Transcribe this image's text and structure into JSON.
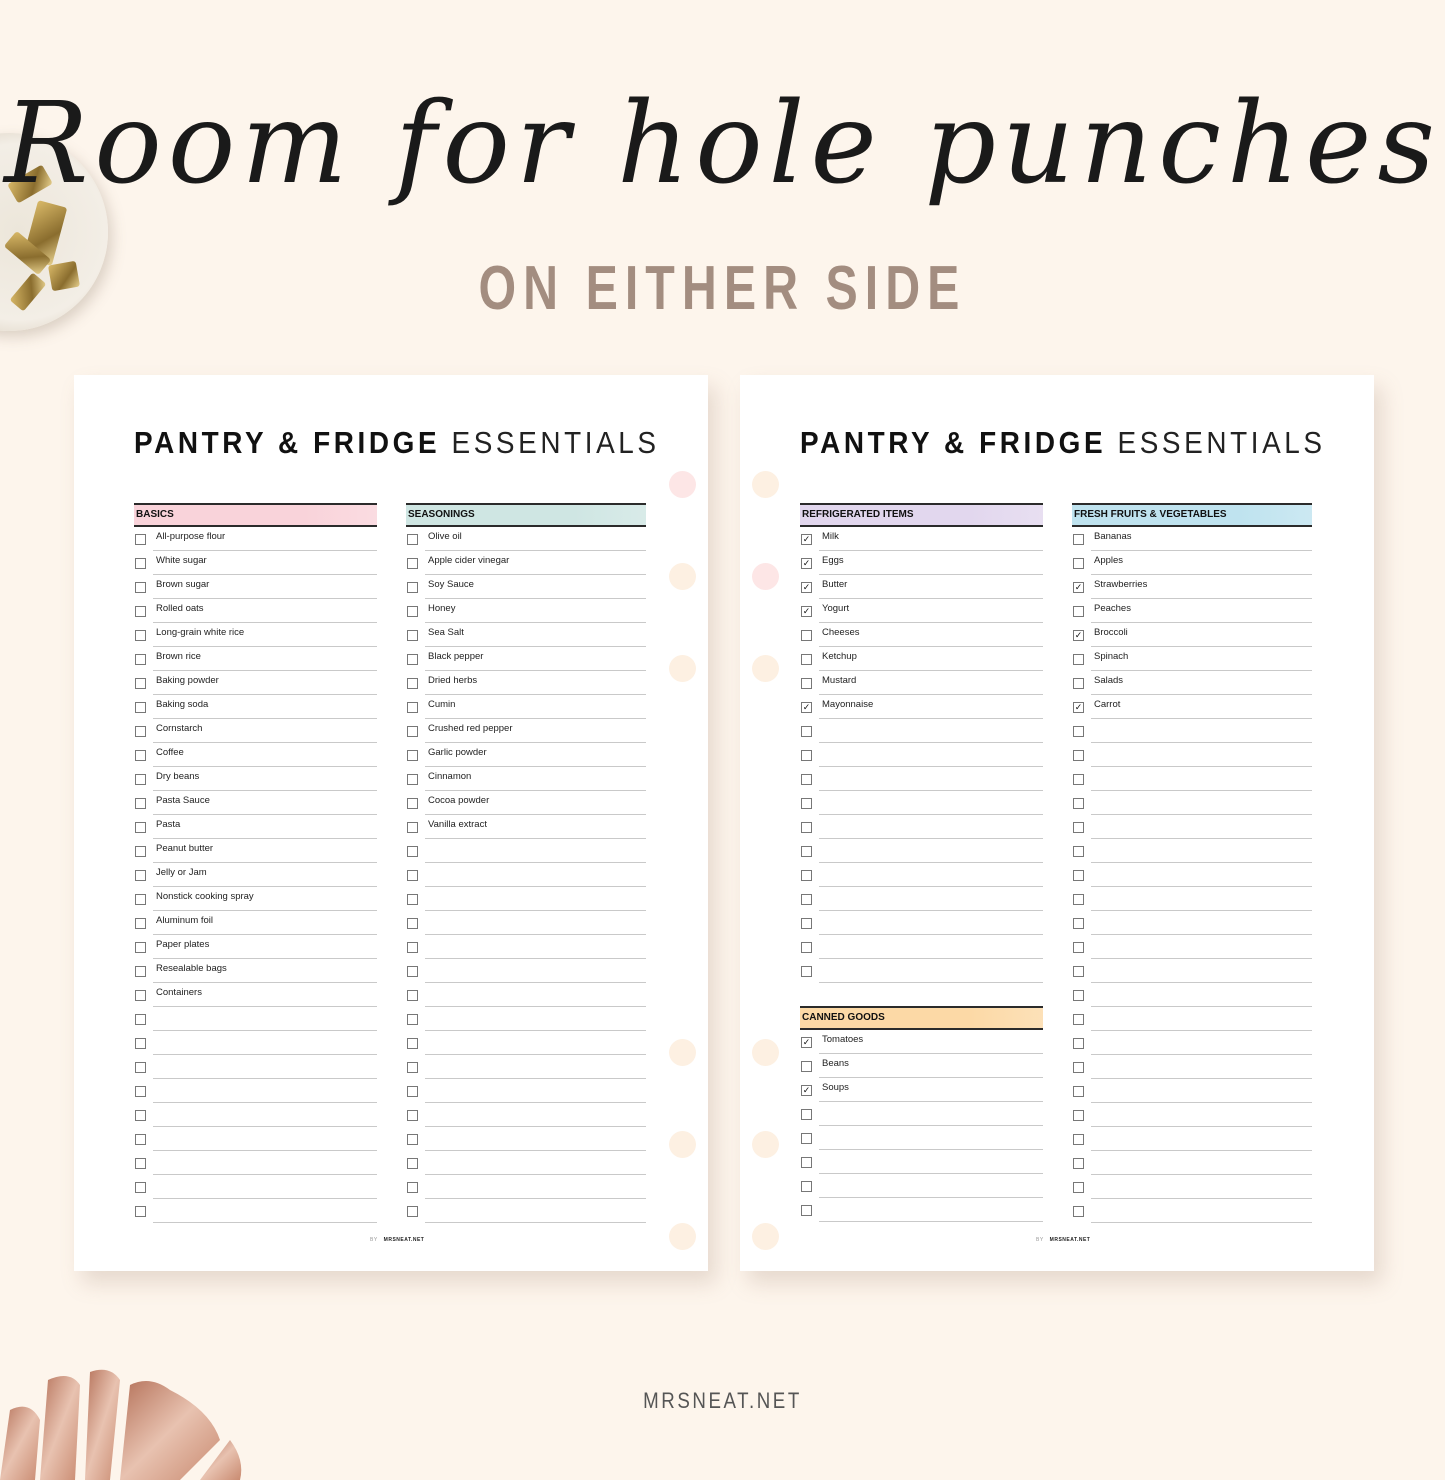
{
  "headline": {
    "script": "Room for hole punches",
    "subtitle": "ON EITHER SIDE"
  },
  "footer": "MRSNEAT.NET",
  "colors": {
    "background": "#fdf5ec",
    "subtitle": "#a38d80",
    "basics": "#f9d3da",
    "seasonings": "#cfe6e3",
    "refrigerated": "#e2d7ee",
    "fresh": "#bfe3ef",
    "canned": "#fcd9a6",
    "hole_pink": "#fde6e6",
    "hole_peach": "#fdf0e2"
  },
  "pages": [
    {
      "title_bold": "PANTRY & FRIDGE",
      "title_thin": "ESSENTIALS",
      "byline_by": "BY",
      "byline_site": "MRSNEAT.NET",
      "sections": [
        {
          "title": "BASICS",
          "color_key": "basics",
          "rows": 29,
          "items": [
            {
              "label": "All-purpose flour",
              "checked": false
            },
            {
              "label": "White sugar",
              "checked": false
            },
            {
              "label": "Brown sugar",
              "checked": false
            },
            {
              "label": "Rolled oats",
              "checked": false
            },
            {
              "label": "Long-grain white rice",
              "checked": false
            },
            {
              "label": "Brown rice",
              "checked": false
            },
            {
              "label": "Baking powder",
              "checked": false
            },
            {
              "label": "Baking soda",
              "checked": false
            },
            {
              "label": "Cornstarch",
              "checked": false
            },
            {
              "label": "Coffee",
              "checked": false
            },
            {
              "label": "Dry beans",
              "checked": false
            },
            {
              "label": "Pasta Sauce",
              "checked": false
            },
            {
              "label": "Pasta",
              "checked": false
            },
            {
              "label": "Peanut butter",
              "checked": false
            },
            {
              "label": "Jelly or Jam",
              "checked": false
            },
            {
              "label": "Nonstick cooking spray",
              "checked": false
            },
            {
              "label": "Aluminum foil",
              "checked": false
            },
            {
              "label": "Paper plates",
              "checked": false
            },
            {
              "label": "Resealable bags",
              "checked": false
            },
            {
              "label": "Containers",
              "checked": false
            }
          ]
        },
        {
          "title": "SEASONINGS",
          "color_key": "seasonings",
          "rows": 29,
          "items": [
            {
              "label": "Olive oil",
              "checked": false
            },
            {
              "label": "Apple cider vinegar",
              "checked": false
            },
            {
              "label": "Soy Sauce",
              "checked": false
            },
            {
              "label": "Honey",
              "checked": false
            },
            {
              "label": "Sea Salt",
              "checked": false
            },
            {
              "label": "Black pepper",
              "checked": false
            },
            {
              "label": "Dried herbs",
              "checked": false
            },
            {
              "label": "Cumin",
              "checked": false
            },
            {
              "label": "Crushed red pepper",
              "checked": false
            },
            {
              "label": "Garlic powder",
              "checked": false
            },
            {
              "label": "Cinnamon",
              "checked": false
            },
            {
              "label": "Cocoa powder",
              "checked": false
            },
            {
              "label": "Vanilla extract",
              "checked": false
            }
          ]
        }
      ]
    },
    {
      "title_bold": "PANTRY & FRIDGE",
      "title_thin": "ESSENTIALS",
      "byline_by": "BY",
      "byline_site": "MRSNEAT.NET",
      "sections": [
        {
          "title": "REFRIGERATED ITEMS",
          "color_key": "refrigerated",
          "rows": 19,
          "items": [
            {
              "label": "Milk",
              "checked": true
            },
            {
              "label": "Eggs",
              "checked": true
            },
            {
              "label": "Butter",
              "checked": true
            },
            {
              "label": "Yogurt",
              "checked": true
            },
            {
              "label": "Cheeses",
              "checked": false
            },
            {
              "label": "Ketchup",
              "checked": false
            },
            {
              "label": "Mustard",
              "checked": false
            },
            {
              "label": "Mayonnaise",
              "checked": true
            }
          ]
        },
        {
          "title": "FRESH FRUITS & VEGETABLES",
          "color_key": "fresh",
          "rows": 29,
          "items": [
            {
              "label": "Bananas",
              "checked": false
            },
            {
              "label": "Apples",
              "checked": false
            },
            {
              "label": "Strawberries",
              "checked": true
            },
            {
              "label": "Peaches",
              "checked": false
            },
            {
              "label": "Broccoli",
              "checked": true
            },
            {
              "label": "Spinach",
              "checked": false
            },
            {
              "label": "Salads",
              "checked": false
            },
            {
              "label": "Carrot",
              "checked": true
            }
          ]
        },
        {
          "title": "CANNED GOODS",
          "color_key": "canned",
          "rows": 8,
          "items": [
            {
              "label": "Tomatoes",
              "checked": true
            },
            {
              "label": "Beans",
              "checked": false
            },
            {
              "label": "Soups",
              "checked": true
            }
          ]
        }
      ]
    }
  ],
  "check_glyph": "✓"
}
